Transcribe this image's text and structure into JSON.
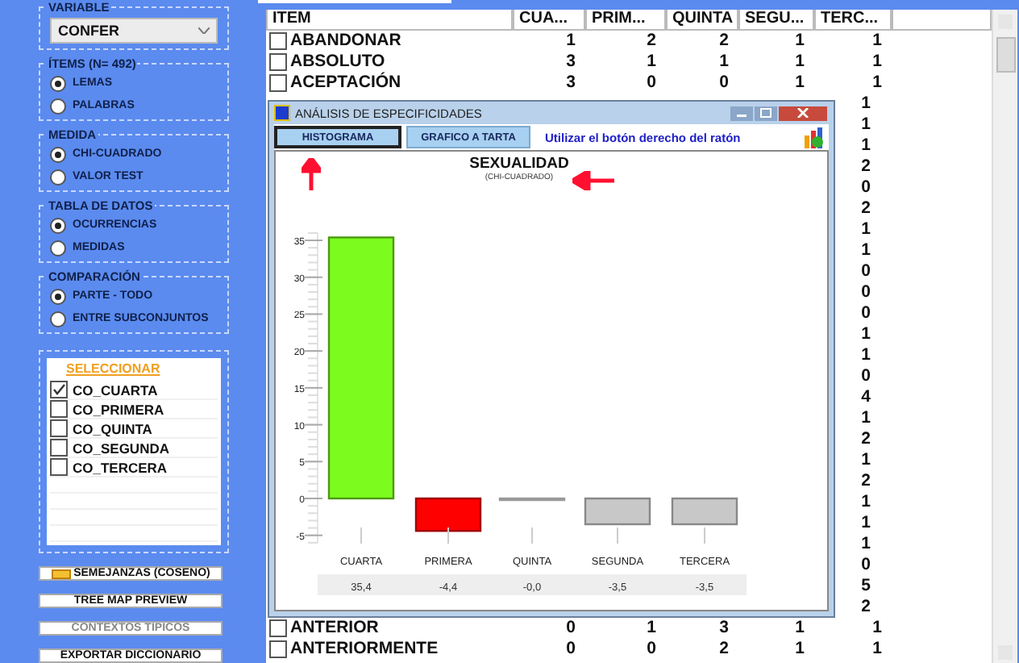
{
  "sidebar": {
    "variable": {
      "legend": "VARIABLE",
      "value": "CONFER"
    },
    "groups": [
      {
        "legend": "ÍTEMS (N= 492)",
        "options": [
          {
            "label": "LEMAS",
            "selected": true
          },
          {
            "label": "PALABRAS",
            "selected": false
          }
        ]
      },
      {
        "legend": "MEDIDA",
        "options": [
          {
            "label": "CHI-CUADRADO",
            "selected": true
          },
          {
            "label": "VALOR TEST",
            "selected": false
          }
        ]
      },
      {
        "legend": "TABLA DE DATOS",
        "options": [
          {
            "label": "OCURRENCIAS",
            "selected": true
          },
          {
            "label": "MEDIDAS",
            "selected": false
          }
        ]
      },
      {
        "legend": "COMPARACIÓN",
        "options": [
          {
            "label": "PARTE - TODO",
            "selected": true
          },
          {
            "label": "ENTRE SUBCONJUNTOS",
            "selected": false
          }
        ]
      }
    ],
    "select_list": {
      "title": "SELECCIONAR",
      "items": [
        {
          "label": "CO_CUARTA",
          "checked": true
        },
        {
          "label": "CO_PRIMERA",
          "checked": false
        },
        {
          "label": "CO_QUINTA",
          "checked": false
        },
        {
          "label": "CO_SEGUNDA",
          "checked": false
        },
        {
          "label": "CO_TERCERA",
          "checked": false
        }
      ]
    },
    "buttons": [
      {
        "label": "SEMEJANZAS (COSENO)",
        "disabled": false,
        "kind": "icon"
      },
      {
        "label": "TREE MAP PREVIEW",
        "disabled": false,
        "kind": "plain"
      },
      {
        "label": "CONTEXTOS TIPICOS",
        "disabled": true,
        "kind": "plain"
      },
      {
        "label": "EXPORTAR DICCIONARIO",
        "disabled": false,
        "kind": "plain"
      }
    ]
  },
  "table": {
    "columns": [
      "ITEM",
      "CUA...",
      "PRIM...",
      "QUINTA",
      "SEGU...",
      "TERC..."
    ],
    "rows": [
      {
        "kind": "full",
        "item": "ABANDONAR",
        "checked": false,
        "values": [
          "1",
          "2",
          "2",
          "1",
          "1"
        ]
      },
      {
        "kind": "full",
        "item": "ABSOLUTO",
        "checked": false,
        "values": [
          "3",
          "1",
          "1",
          "1",
          "1"
        ]
      },
      {
        "kind": "full",
        "item": "ACEPTACIÓN",
        "checked": false,
        "values": [
          "3",
          "0",
          "0",
          "1",
          "1"
        ]
      },
      {
        "kind": "covered",
        "values": [
          "1"
        ]
      },
      {
        "kind": "covered",
        "values": [
          "1"
        ]
      },
      {
        "kind": "covered",
        "values": [
          "1"
        ]
      },
      {
        "kind": "covered",
        "values": [
          "2"
        ]
      },
      {
        "kind": "covered",
        "values": [
          "0"
        ]
      },
      {
        "kind": "covered",
        "values": [
          "2"
        ]
      },
      {
        "kind": "covered",
        "values": [
          "1"
        ]
      },
      {
        "kind": "covered",
        "values": [
          "1"
        ]
      },
      {
        "kind": "covered",
        "values": [
          "0"
        ]
      },
      {
        "kind": "covered",
        "values": [
          "0"
        ]
      },
      {
        "kind": "covered",
        "values": [
          "0"
        ]
      },
      {
        "kind": "covered",
        "values": [
          "1"
        ]
      },
      {
        "kind": "covered",
        "values": [
          "1"
        ]
      },
      {
        "kind": "covered",
        "values": [
          "0"
        ]
      },
      {
        "kind": "covered",
        "values": [
          "4"
        ]
      },
      {
        "kind": "covered",
        "values": [
          "1"
        ]
      },
      {
        "kind": "covered",
        "values": [
          "2"
        ]
      },
      {
        "kind": "covered",
        "values": [
          "1"
        ]
      },
      {
        "kind": "covered",
        "values": [
          "2"
        ]
      },
      {
        "kind": "covered",
        "values": [
          "1"
        ]
      },
      {
        "kind": "covered",
        "values": [
          "1"
        ]
      },
      {
        "kind": "covered",
        "values": [
          "1"
        ]
      },
      {
        "kind": "covered",
        "values": [
          "0"
        ]
      },
      {
        "kind": "covered",
        "values": [
          "5"
        ]
      },
      {
        "kind": "covered",
        "values": [
          "2"
        ]
      },
      {
        "kind": "full",
        "item": "ANTERIOR",
        "checked": false,
        "values": [
          "0",
          "1",
          "3",
          "1",
          "1"
        ]
      },
      {
        "kind": "full",
        "item": "ANTERIORMENTE",
        "checked": false,
        "values": [
          "0",
          "0",
          "2",
          "1",
          "1"
        ]
      }
    ]
  },
  "dialog": {
    "title": "ANÁLISIS DE ESPECIFICIDADES",
    "tabs": [
      {
        "label": "HISTOGRAMA",
        "selected": true
      },
      {
        "label": "GRAFICO A TARTA",
        "selected": false
      }
    ],
    "hint": "Utilizar el botón derecho del ratón",
    "subtitle": "(CHI-CUADRADO)",
    "chart_data": {
      "type": "bar",
      "title": "SEXUALIDAD",
      "categories": [
        "CUARTA",
        "PRIMERA",
        "QUINTA",
        "SEGUNDA",
        "TERCERA"
      ],
      "values": [
        35.4,
        -4.4,
        -0.0,
        -3.5,
        -3.5
      ],
      "ylim": [
        -6,
        36
      ],
      "yticks": [
        -5,
        0,
        5,
        10,
        15,
        20,
        25,
        30,
        35
      ],
      "value_labels": [
        "35,4",
        "-4,4",
        "-0,0",
        "-3,5",
        "-3,5"
      ]
    }
  }
}
